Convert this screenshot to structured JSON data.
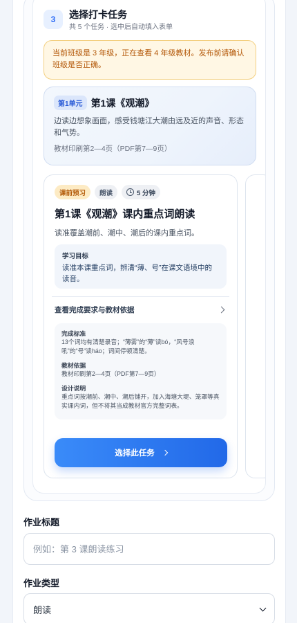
{
  "step": {
    "number": "3",
    "title": "选择打卡任务",
    "subtitle": "共 5 个任务 · 选中后自动填入表单"
  },
  "notice": "当前班级是 3 年级，正在查看 4 年级教材。发布前请确认班级是否正确。",
  "unit": {
    "tag": "第1单元",
    "title": "第1课《观潮》",
    "description": "边读边想象画面，感受钱塘江大潮由远及近的声音、形态和气势。",
    "reference": "教材印刷第2—4页（PDF第7—9页）"
  },
  "task": {
    "chips": {
      "preview": "课前预习",
      "type": "朗读",
      "duration": "5 分钟"
    },
    "title": "第1课《观潮》课内重点词朗读",
    "description": "读准覆盖潮前、潮中、潮后的课内重点词。",
    "goal_label": "学习目标",
    "goal_text": "读准本课重点词，辨清“薄、号”在课文语境中的读音。",
    "details_toggle": "查看完成要求与教材依据",
    "completion_label": "完成标准",
    "completion_text": "13个词均有清楚录音；“薄雾”的“薄”读bó，“风号浪吼”的“号”读háo；词间停顿清楚。",
    "basis_label": "教材依据",
    "basis_text": "教材印刷第2—4页（PDF第7—9页）",
    "design_label": "设计说明",
    "design_text": "重点词按潮前、潮中、潮后铺开，加入海塘大堤、笼罩等真实课内词，但不将其当成教材官方完整词表。",
    "select_button": "选择此任务"
  },
  "form": {
    "title_label": "作业标题",
    "title_placeholder": "例如：第 3 课朗读练习",
    "type_label": "作业类型",
    "type_value": "朗读"
  }
}
